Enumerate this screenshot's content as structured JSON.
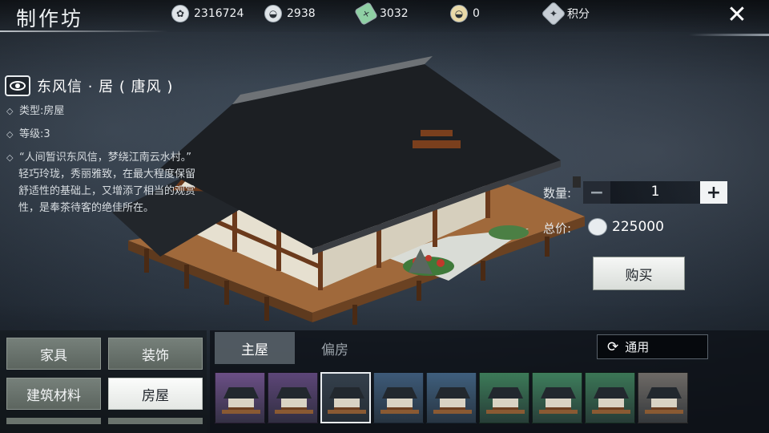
{
  "header": {
    "title": "制作坊",
    "currencies": [
      {
        "icon": "coin-icon",
        "value": "2316724"
      },
      {
        "icon": "silver-ingot-icon",
        "value": "2938"
      },
      {
        "icon": "jade-icon",
        "value": "3032"
      },
      {
        "icon": "gold-ingot-icon",
        "value": "0"
      }
    ],
    "points_label": "积分"
  },
  "item": {
    "name": "东风信 · 居 ( 唐风 )",
    "type": "类型:房屋",
    "level": "等级:3",
    "quote": "“人间暂识东风信，梦绕江南云水村。”",
    "description": "轻巧玲珑，秀丽雅致，在最大程度保留舒适性的基础上，又增添了相当的观赏性，是奉茶待客的绝佳所在。"
  },
  "purchase": {
    "quantity_label": "数量:",
    "quantity": "1",
    "total_label": "总价:",
    "total": "225000",
    "buy_label": "购买"
  },
  "categories": [
    {
      "label": "家具",
      "active": false
    },
    {
      "label": "装饰",
      "active": false
    },
    {
      "label": "建筑材料",
      "active": false
    },
    {
      "label": "房屋",
      "active": true
    }
  ],
  "sub_tabs": [
    {
      "label": "主屋",
      "active": true
    },
    {
      "label": "偏房",
      "active": false
    }
  ],
  "filter_label": "通用",
  "thumbnails": [
    {
      "bg": "#6b4f86",
      "selected": false
    },
    {
      "bg": "#5d4678",
      "selected": false
    },
    {
      "bg": "#34404c",
      "selected": true
    },
    {
      "bg": "#3d5a78",
      "selected": false
    },
    {
      "bg": "#3f5f7d",
      "selected": false
    },
    {
      "bg": "#3c7a58",
      "selected": false
    },
    {
      "bg": "#3e7e5c",
      "selected": false
    },
    {
      "bg": "#3b7656",
      "selected": false
    },
    {
      "bg": "#6e6a66",
      "selected": false
    }
  ],
  "colors": {
    "roof": "#1c1f23",
    "wood": "#6b3a1c",
    "deck": "#a0693b",
    "wall": "#e6e0d0",
    "accent_white": "#f4f6f7"
  }
}
